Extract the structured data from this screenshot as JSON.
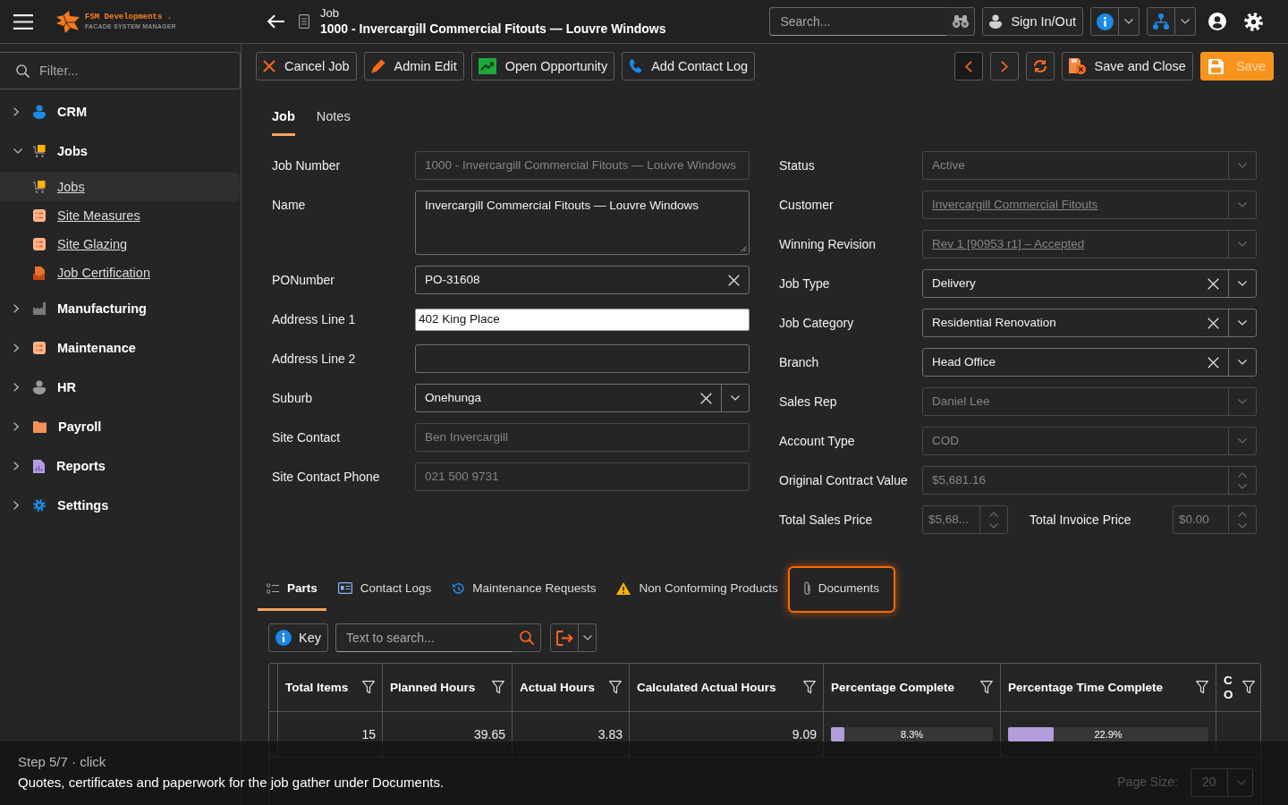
{
  "brand": {
    "name": "FSM Developments .",
    "tagline": "FACADE SYSTEM MANAGER"
  },
  "header": {
    "section": "Job",
    "title": "1000 - Invercargill Commercial Fitouts — Louvre Windows"
  },
  "top_bar": {
    "search_placeholder": "Search...",
    "sign_in": "Sign In/Out"
  },
  "sidebar": {
    "filter_placeholder": "Filter...",
    "items": [
      {
        "label": "CRM",
        "expanded": false
      },
      {
        "label": "Jobs",
        "expanded": true,
        "children": [
          {
            "label": "Jobs",
            "selected": true
          },
          {
            "label": "Site Measures",
            "selected": false
          },
          {
            "label": "Site Glazing",
            "selected": false
          },
          {
            "label": "Job Certification",
            "selected": false
          }
        ]
      },
      {
        "label": "Manufacturing",
        "expanded": false
      },
      {
        "label": "Maintenance",
        "expanded": false
      },
      {
        "label": "HR",
        "expanded": false
      },
      {
        "label": "Payroll",
        "expanded": false
      },
      {
        "label": "Reports",
        "expanded": false
      },
      {
        "label": "Settings",
        "expanded": false
      }
    ]
  },
  "toolbar": {
    "actions": [
      {
        "label": "Cancel Job"
      },
      {
        "label": "Admin Edit"
      },
      {
        "label": "Open Opportunity"
      },
      {
        "label": "Add Contact Log"
      }
    ],
    "nav": [
      {
        "disabled": true
      },
      {
        "disabled": false
      },
      {
        "disabled": false
      }
    ],
    "save_close": "Save and Close",
    "save": {
      "label": "Save",
      "disabled": true
    }
  },
  "form_tabs": [
    {
      "label": "Job",
      "selected": true
    },
    {
      "label": "Notes",
      "selected": false
    }
  ],
  "form": {
    "left": [
      {
        "label": "Job Number",
        "kind": "text",
        "value": "1000 - Invercargill Commercial Fitouts — Louvre Windows",
        "disabled": true,
        "clearable": false,
        "focused": false
      },
      {
        "label": "Name",
        "kind": "textarea",
        "value": "Invercargill Commercial Fitouts — Louvre Windows",
        "disabled": false,
        "clearable": false,
        "focused": false
      },
      {
        "label": "PONumber",
        "kind": "text",
        "value": "PO-31608",
        "disabled": false,
        "clearable": true,
        "focused": false
      },
      {
        "label": "Address Line 1",
        "kind": "text",
        "value": "402 King Place",
        "disabled": false,
        "clearable": false,
        "focused": true
      },
      {
        "label": "Address Line 2",
        "kind": "text",
        "disabled": false,
        "clearable": false,
        "focused": false
      },
      {
        "label": "Suburb",
        "kind": "combo",
        "value": "Onehunga",
        "disabled": false,
        "clearable": true,
        "focused": false
      },
      {
        "label": "Site Contact",
        "kind": "text",
        "value": "Ben Invercargill",
        "disabled": true,
        "clearable": false,
        "focused": false
      },
      {
        "label": "Site Contact Phone",
        "kind": "text",
        "value": "021 500 9731",
        "disabled": true,
        "clearable": false,
        "focused": false
      }
    ],
    "right": [
      {
        "label": "Status",
        "kind": "combo",
        "value": "Active",
        "disabled": true,
        "clearable": false,
        "link": false
      },
      {
        "label": "Customer",
        "kind": "combo",
        "value": "Invercargill Commercial Fitouts",
        "disabled": true,
        "clearable": false,
        "link": true
      },
      {
        "label": "Winning Revision",
        "kind": "combo",
        "value": "Rev 1 [90953 r1] – Accepted",
        "disabled": true,
        "clearable": false,
        "link": true
      },
      {
        "label": "Job Type",
        "kind": "combo",
        "value": "Delivery",
        "disabled": false,
        "clearable": true,
        "link": false
      },
      {
        "label": "Job Category",
        "kind": "combo",
        "value": "Residential Renovation",
        "disabled": false,
        "clearable": true,
        "link": false
      },
      {
        "label": "Branch",
        "kind": "combo",
        "value": "Head Office",
        "disabled": false,
        "clearable": true,
        "link": false
      },
      {
        "label": "Sales Rep",
        "kind": "combo",
        "value": "Daniel Lee",
        "disabled": true,
        "clearable": false,
        "link": false
      },
      {
        "label": "Account Type",
        "kind": "combo",
        "value": "COD",
        "disabled": true,
        "clearable": false,
        "link": false
      },
      {
        "label": "Original Contract Value",
        "kind": "number",
        "value": "$5,681.16",
        "disabled": true,
        "clearable": false,
        "link": false
      }
    ],
    "totals": [
      {
        "label": "Total Sales Price",
        "kind": "number",
        "value": "$5,68...",
        "disabled": true
      },
      {
        "label": "Total Invoice Price",
        "kind": "number",
        "value": "$0.00",
        "disabled": true
      }
    ]
  },
  "detail_tabs": [
    {
      "label": "Parts",
      "selected": true,
      "highlighted": false
    },
    {
      "label": "Contact Logs",
      "selected": false,
      "highlighted": false
    },
    {
      "label": "Maintenance Requests",
      "selected": false,
      "highlighted": false
    },
    {
      "label": "Non Conforming Products",
      "selected": false,
      "highlighted": false
    },
    {
      "label": "Documents",
      "selected": false,
      "highlighted": true
    }
  ],
  "grid_toolbar": {
    "key": "Key",
    "search_placeholder": "Text to search..."
  },
  "grid": {
    "columns": [
      {
        "header": "Total Items"
      },
      {
        "header": "Planned Hours"
      },
      {
        "header": "Actual Hours"
      },
      {
        "header": "Calculated Actual Hours"
      },
      {
        "header": "Percentage Complete"
      },
      {
        "header": "Percentage Time Complete"
      },
      {
        "header": "C O"
      }
    ],
    "rows": [
      {
        "cells": [
          {
            "kind": "number",
            "text": "15"
          },
          {
            "kind": "number",
            "text": "39.65"
          },
          {
            "kind": "number",
            "text": "3.83"
          },
          {
            "kind": "number",
            "text": "9.09"
          },
          {
            "kind": "progress",
            "level": 0.083,
            "text": "8.3%"
          },
          {
            "kind": "progress",
            "level": 0.229,
            "text": "22.9%"
          }
        ]
      }
    ],
    "pager": {
      "page_size_label": "Page Size:",
      "page_size": "20"
    }
  },
  "tour": {
    "step": "Step 5/7 · click",
    "message": "Quotes, certificates and paperwork for the job gather under Documents."
  }
}
